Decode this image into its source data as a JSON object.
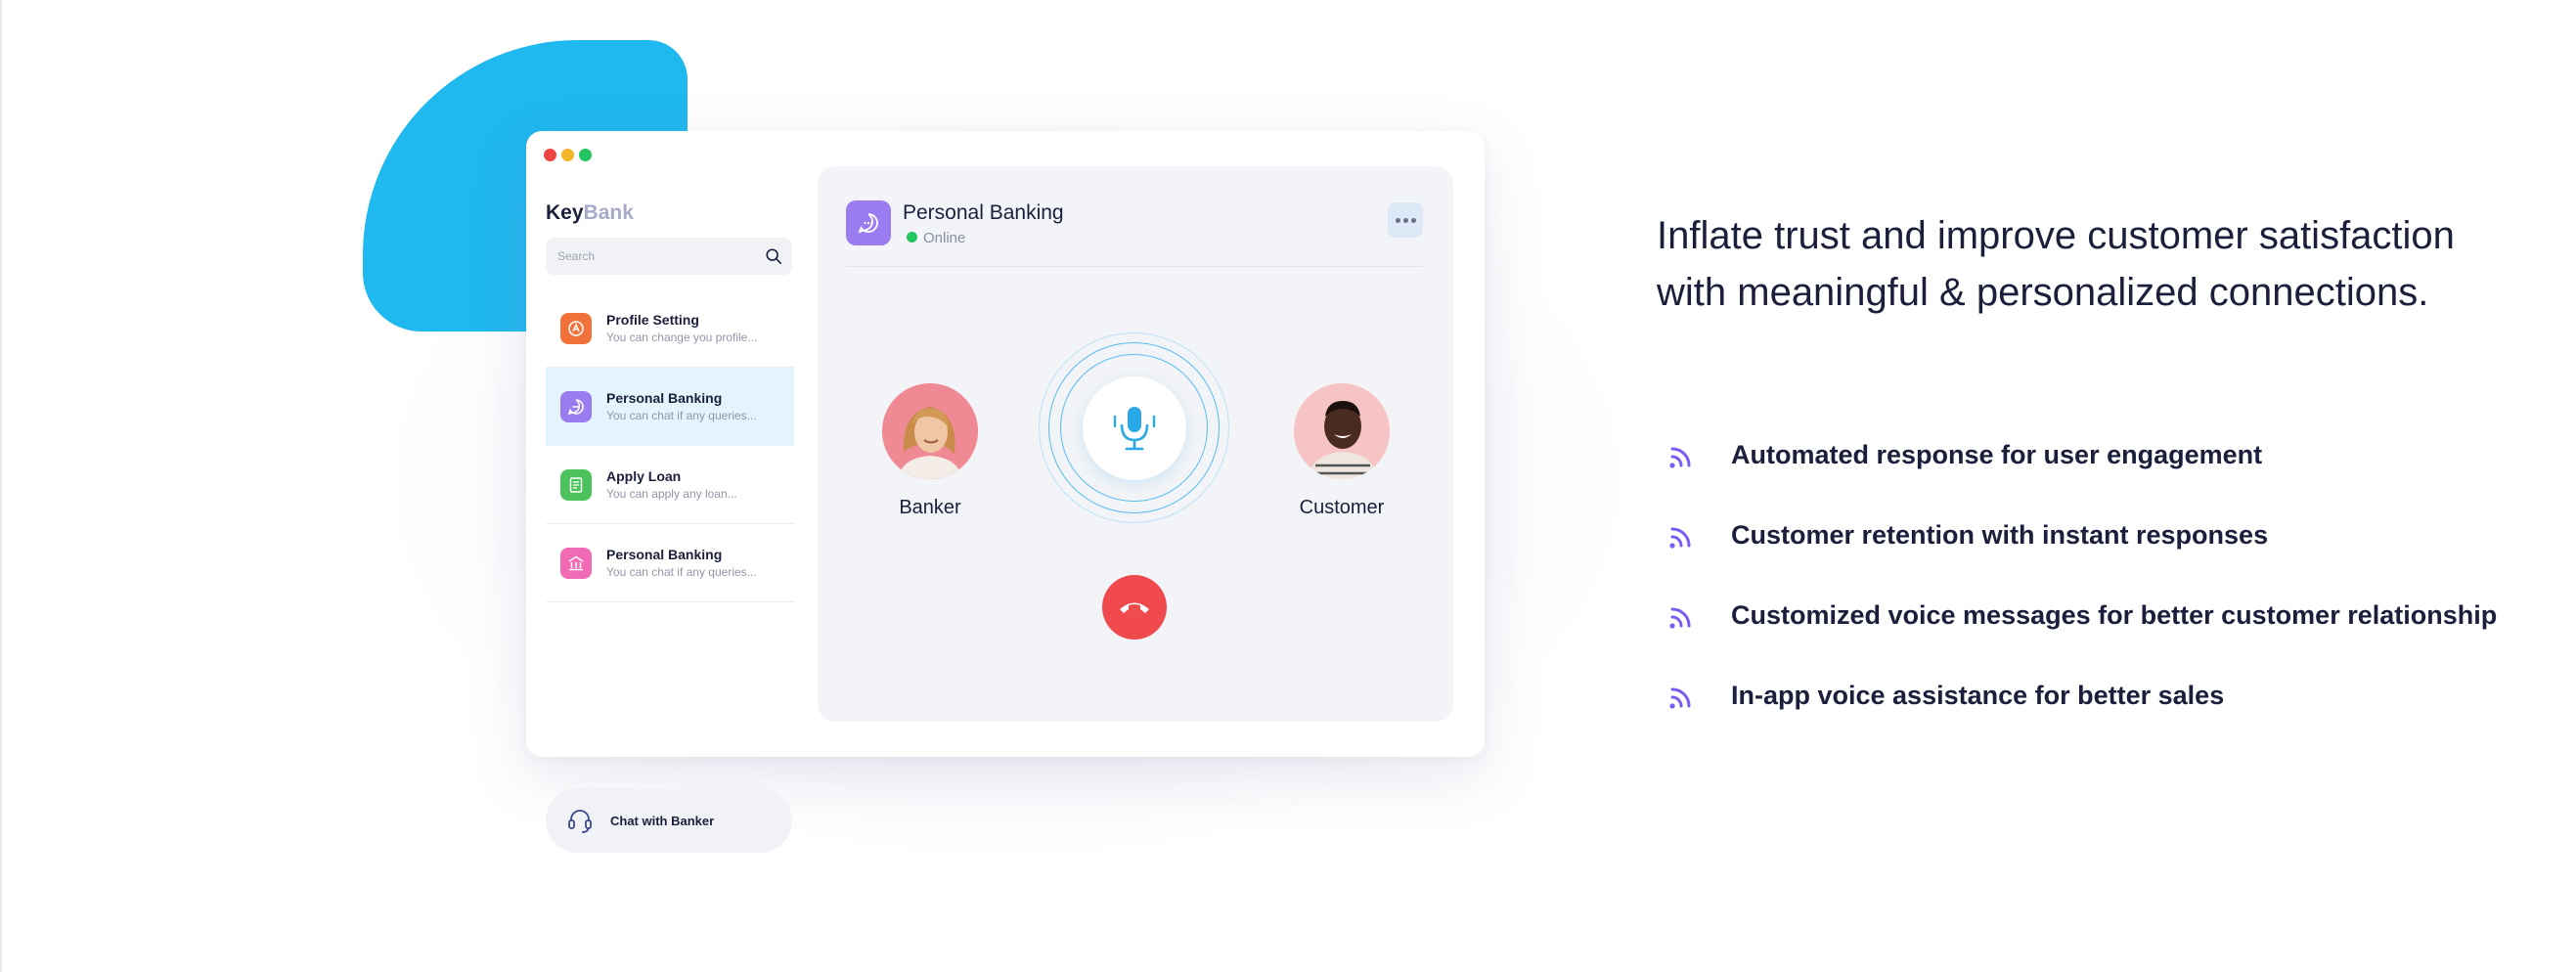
{
  "app": {
    "logo_key": "Key",
    "logo_bank": "Bank",
    "window_controls": [
      "close",
      "minimize",
      "maximize"
    ]
  },
  "search": {
    "placeholder": "Search",
    "icon": "search-icon"
  },
  "sidebar": {
    "items": [
      {
        "title": "Profile Setting",
        "subtitle": "You can change you profile...",
        "icon": "profile-icon",
        "color": "#f2703a"
      },
      {
        "title": "Personal Banking",
        "subtitle": "You can chat if any queries...",
        "icon": "chat-bubble-icon",
        "color": "#9b7cf0",
        "active": true
      },
      {
        "title": "Apply Loan",
        "subtitle": "You can apply any loan...",
        "icon": "document-icon",
        "color": "#4cc35a"
      },
      {
        "title": "Personal Banking",
        "subtitle": "You can chat if any queries...",
        "icon": "bank-building-icon",
        "color": "#f06ab5"
      }
    ],
    "chat_with_banker": "Chat with Banker"
  },
  "call": {
    "title": "Personal Banking",
    "status": "Online",
    "banker_label": "Banker",
    "customer_label": "Customer",
    "mic_icon": "microphone-icon",
    "hangup_icon": "phone-hangup-icon"
  },
  "marketing": {
    "headline": "Inflate trust and improve customer satisfaction with meaningful & personalized connections.",
    "features": [
      "Automated response for user engagement",
      "Customer retention with instant responses",
      "Customized voice messages for better customer relationship",
      "In-app voice assistance for better sales"
    ],
    "feature_icon": "voice-waves-icon"
  },
  "colors": {
    "accent_blue": "#1fb8ef",
    "accent_purple": "#7b5cf0",
    "hangup_red": "#f04a4e",
    "online_green": "#22c55e"
  }
}
